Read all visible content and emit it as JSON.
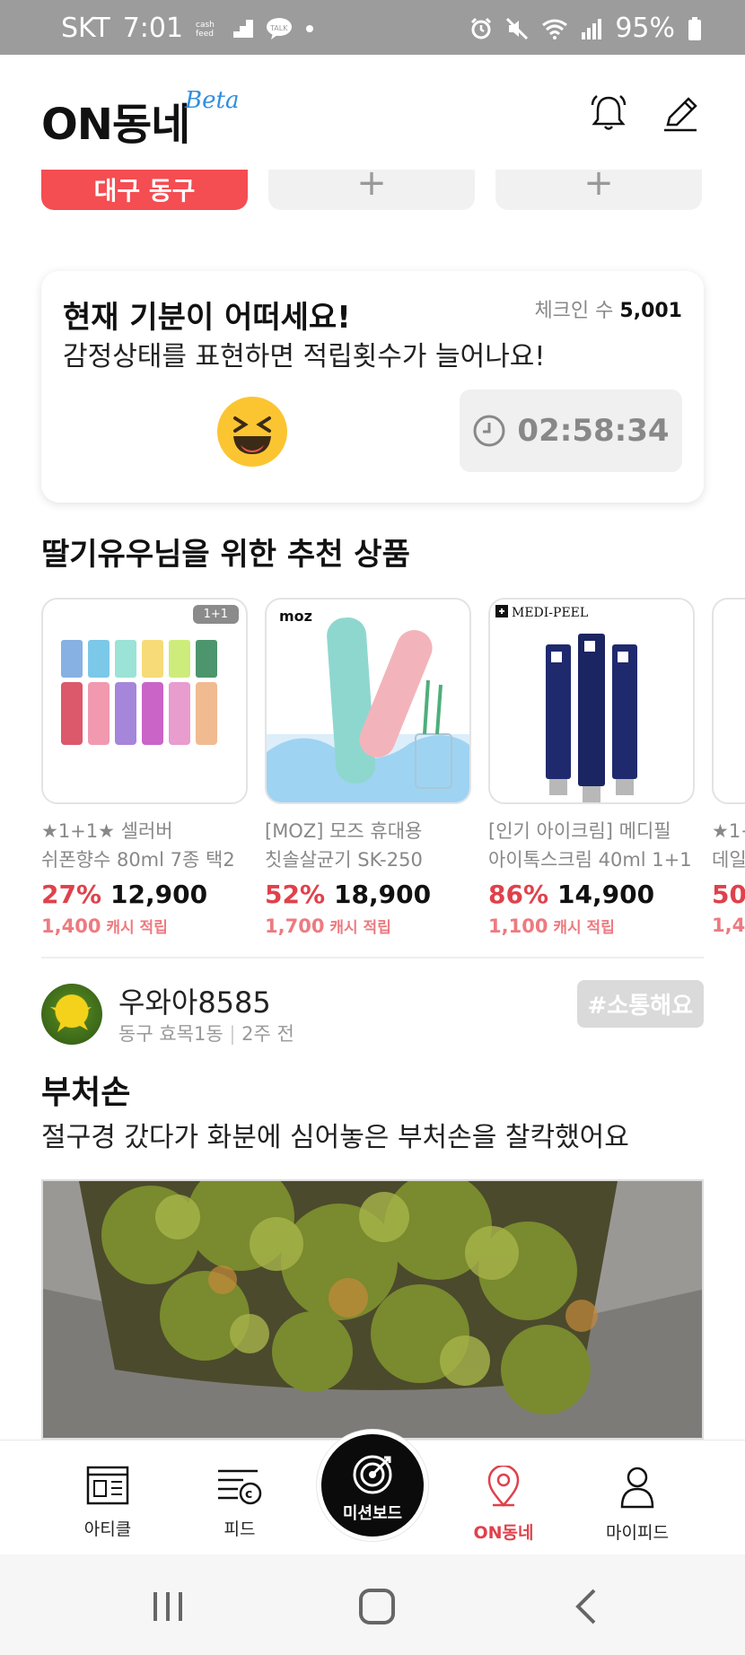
{
  "status_bar": {
    "carrier": "SKT",
    "time": "7:01",
    "battery": "95%"
  },
  "header": {
    "logo": "ON동네",
    "beta": "Beta"
  },
  "top_cards": {
    "first_label": "대구 동구",
    "add_symbol": "+"
  },
  "mood_card": {
    "title": "현재 기분이 어떠세요!",
    "subtitle": "감정상태를 표현하면 적립횟수가 늘어나요!",
    "checkin_label": "체크인 수",
    "checkin_count": "5,001",
    "timer": "02:58:34"
  },
  "recommendations": {
    "title": "딸기유우님을 위한 추천 상품",
    "products": [
      {
        "badge": "1+1",
        "line1": "★1+1★ 셀러버",
        "line2": "쉬폰향수 80ml 7종 택2",
        "discount": "27%",
        "price": "12,900",
        "cash_amount": "1,400",
        "cash_label": "캐시 적립"
      },
      {
        "brand": "moz",
        "line1": "[MOZ] 모즈 휴대용",
        "line2": "칫솔살균기 SK-250",
        "discount": "52%",
        "price": "18,900",
        "cash_amount": "1,700",
        "cash_label": "캐시 적립"
      },
      {
        "brand": "MEDI-PEEL",
        "line1": "[인기 아이크림] 메디필",
        "line2": "아이톡스크림 40ml 1+1",
        "discount": "86%",
        "price": "14,900",
        "cash_amount": "1,100",
        "cash_label": "캐시 적립"
      },
      {
        "line1": "★1+",
        "line2": "데일",
        "discount": "50%",
        "price": "",
        "cash_amount": "1,4",
        "cash_label": ""
      }
    ]
  },
  "post": {
    "author": "우와아8585",
    "location": "동구 효목1동",
    "time_ago": "2주 전",
    "tag": "#소통해요",
    "title": "부처손",
    "body": "절구경 갔다가 화분에 심어놓은 부처손을 찰칵했어요"
  },
  "bottom_nav": {
    "items": [
      {
        "label": "아티클",
        "icon": "article-icon"
      },
      {
        "label": "피드",
        "icon": "feed-icon"
      },
      {
        "label": "미션보드",
        "icon": "target-icon"
      },
      {
        "label": "ON동네",
        "icon": "location-pin-icon"
      },
      {
        "label": "마이피드",
        "icon": "person-icon"
      }
    ]
  },
  "colors": {
    "accent": "#e0414b",
    "accent_light": "#ee7a80",
    "beta_blue": "#2f8ee0",
    "status_bar": "#9c9c9c",
    "emoji_yellow": "#fbc531"
  }
}
